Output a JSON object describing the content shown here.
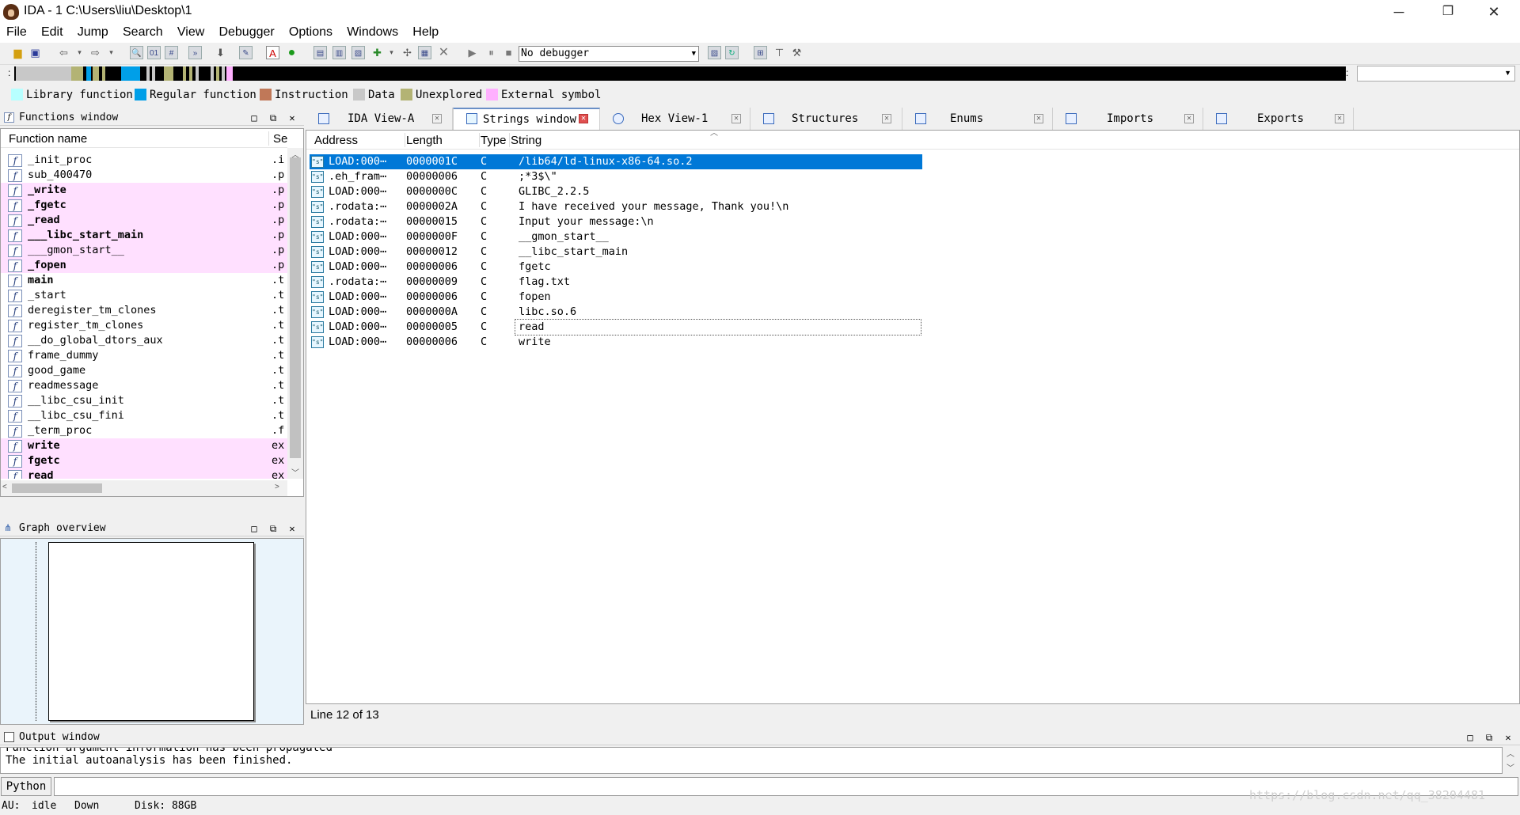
{
  "window": {
    "title": "IDA - 1 C:\\Users\\liu\\Desktop\\1",
    "minimize": "─",
    "restore": "❐",
    "close": "✕"
  },
  "menu": [
    "File",
    "Edit",
    "Jump",
    "Search",
    "View",
    "Debugger",
    "Options",
    "Windows",
    "Help"
  ],
  "toolbar": {
    "debugger_select": "No debugger"
  },
  "legend": [
    {
      "label": "Library function",
      "color": "#b7ffff"
    },
    {
      "label": "Regular function",
      "color": "#009fe8"
    },
    {
      "label": "Instruction",
      "color": "#c07858"
    },
    {
      "label": "Data",
      "color": "#c8c8c8"
    },
    {
      "label": "Unexplored",
      "color": "#b3b374"
    },
    {
      "label": "External symbol",
      "color": "#ffb0ff"
    }
  ],
  "functions_window": {
    "title": "Functions window",
    "col_name": "Function name",
    "col_segment": "Se",
    "rows": [
      {
        "name": "_init_proc",
        "seg": ".i",
        "import": false
      },
      {
        "name": "sub_400470",
        "seg": ".p",
        "import": false
      },
      {
        "name": "_write",
        "seg": ".p",
        "import": true
      },
      {
        "name": "_fgetc",
        "seg": ".p",
        "import": true
      },
      {
        "name": "_read",
        "seg": ".p",
        "import": true
      },
      {
        "name": "___libc_start_main",
        "seg": ".p",
        "import": true
      },
      {
        "name": "___gmon_start__",
        "seg": ".p",
        "import": true
      },
      {
        "name": "_fopen",
        "seg": ".p",
        "import": true
      },
      {
        "name": "main",
        "seg": ".t",
        "import": false
      },
      {
        "name": "_start",
        "seg": ".t",
        "import": false
      },
      {
        "name": "deregister_tm_clones",
        "seg": ".t",
        "import": false
      },
      {
        "name": "register_tm_clones",
        "seg": ".t",
        "import": false
      },
      {
        "name": "__do_global_dtors_aux",
        "seg": ".t",
        "import": false
      },
      {
        "name": "frame_dummy",
        "seg": ".t",
        "import": false
      },
      {
        "name": "good_game",
        "seg": ".t",
        "import": false
      },
      {
        "name": "readmessage",
        "seg": ".t",
        "import": false
      },
      {
        "name": "__libc_csu_init",
        "seg": ".t",
        "import": false
      },
      {
        "name": "__libc_csu_fini",
        "seg": ".t",
        "import": false
      },
      {
        "name": "_term_proc",
        "seg": ".f",
        "import": false
      },
      {
        "name": "write",
        "seg": "ex",
        "import": true
      },
      {
        "name": "fgetc",
        "seg": "ex",
        "import": true
      },
      {
        "name": "read",
        "seg": "ex",
        "import": true
      }
    ],
    "bold": [
      "_write",
      "_fgetc",
      "_read",
      "___libc_start_main",
      "_fopen",
      "main",
      "write",
      "fgetc",
      "read"
    ]
  },
  "graph_overview": {
    "title": "Graph overview"
  },
  "tabs": [
    {
      "label": "IDA View-A",
      "active": false
    },
    {
      "label": "Strings window",
      "active": true
    },
    {
      "label": "Hex View-1",
      "active": false
    },
    {
      "label": "Structures",
      "active": false
    },
    {
      "label": "Enums",
      "active": false
    },
    {
      "label": "Imports",
      "active": false
    },
    {
      "label": "Exports",
      "active": false
    }
  ],
  "strings_window": {
    "col_address": "Address",
    "col_length": "Length",
    "col_type": "Type",
    "col_string": "String",
    "rows": [
      {
        "addr": "LOAD:000⋯",
        "len": "0000001C",
        "type": "C",
        "str": "/lib64/ld-linux-x86-64.so.2"
      },
      {
        "addr": ".eh_fram⋯",
        "len": "00000006",
        "type": "C",
        "str": ";*3$\\\""
      },
      {
        "addr": "LOAD:000⋯",
        "len": "0000000C",
        "type": "C",
        "str": "GLIBC_2.2.5"
      },
      {
        "addr": ".rodata:⋯",
        "len": "0000002A",
        "type": "C",
        "str": "I have received your message, Thank you!\\n"
      },
      {
        "addr": ".rodata:⋯",
        "len": "00000015",
        "type": "C",
        "str": "Input your message:\\n"
      },
      {
        "addr": "LOAD:000⋯",
        "len": "0000000F",
        "type": "C",
        "str": "__gmon_start__"
      },
      {
        "addr": "LOAD:000⋯",
        "len": "00000012",
        "type": "C",
        "str": "__libc_start_main"
      },
      {
        "addr": "LOAD:000⋯",
        "len": "00000006",
        "type": "C",
        "str": "fgetc"
      },
      {
        "addr": ".rodata:⋯",
        "len": "00000009",
        "type": "C",
        "str": "flag.txt"
      },
      {
        "addr": "LOAD:000⋯",
        "len": "00000006",
        "type": "C",
        "str": "fopen"
      },
      {
        "addr": "LOAD:000⋯",
        "len": "0000000A",
        "type": "C",
        "str": "libc.so.6"
      },
      {
        "addr": "LOAD:000⋯",
        "len": "00000005",
        "type": "C",
        "str": "read"
      },
      {
        "addr": "LOAD:000⋯",
        "len": "00000006",
        "type": "C",
        "str": "write"
      }
    ],
    "selected_index": 0,
    "focused_index": 11,
    "status": "Line 12 of 13"
  },
  "output_window": {
    "title": "Output window",
    "lines": [
      "Function argument information has been propagated",
      "The initial autoanalysis has been finished."
    ],
    "python_button": "Python"
  },
  "statusbar": {
    "au_label": "AU:",
    "au_state": "idle",
    "direction": "Down",
    "disk": "Disk: 88GB",
    "watermark": "https://blog.csdn.net/qq_38204481"
  },
  "colors": {
    "selection": "#0078d7",
    "import_row": "#ffe0ff"
  }
}
